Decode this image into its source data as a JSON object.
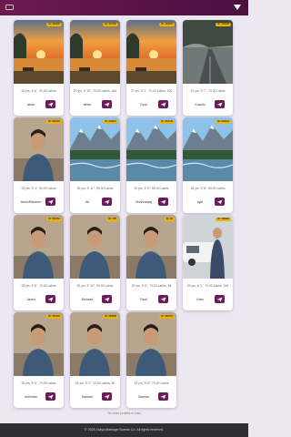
{
  "header": {
    "logo_icon": "logo-icon",
    "filter_icon": "filter-icon"
  },
  "colors": {
    "brand": "#5c1447",
    "badge": "#e9b500",
    "button": "#6a1c58"
  },
  "profiles": [
    {
      "badge": "ID: 459329",
      "info": "26 yrs, 5' 6\", 90,00 Lakhs",
      "name": "Ishan",
      "photo": "sunset-photo"
    },
    {
      "badge": "ID: 417000",
      "info": "22 yrs, 5' 10\", 70,00 Lakhs, 460",
      "name": "Ishan",
      "photo": "sunset-photo"
    },
    {
      "badge": "ID: 459250",
      "info": "27 yrs, 6' 1\", 70,00 Lakhs, 100",
      "name": "Dyal",
      "photo": "sunset-photo"
    },
    {
      "badge": "ID: 416998",
      "info": "31 yrs, 5' 7\", 70,00 Lakhs",
      "name": "Kaushi",
      "photo": "rainy-road-photo"
    },
    {
      "badge": "ID: 459191",
      "info": "29 yrs, 5' 4\", 90,00 Lakhs",
      "name": "AbdulRaheem",
      "photo": "man-photo"
    },
    {
      "badge": "ID: 416917",
      "info": "35 yrs, 5' 11\", 90,00 Lakhs",
      "name": "Ali",
      "photo": "mountain-photo"
    },
    {
      "badge": "ID: 459148",
      "info": "30 yrs, 5' 5\", 90,00 Lakhs",
      "name": "Shahnawaj",
      "photo": "mountain-photo"
    },
    {
      "badge": "ID: 459031",
      "info": "28 yrs, 5' 8\", 90,00 Lakhs",
      "name": "Iqbl",
      "photo": "mountain-photo"
    },
    {
      "badge": "ID: 394457",
      "info": "28 yrs, 5' 6\", 70,00 Lakhs",
      "name": "Javed",
      "photo": "man-photo"
    },
    {
      "badge": "ID: 378",
      "info": "26 yrs, 5' 10\", 90,00 Lakhs",
      "name": "Mohsad",
      "photo": "man-photo"
    },
    {
      "badge": "ID: 96",
      "info": "32 yrs, 5' 5\", 70,00 Lakhs, 64",
      "name": "Rauf",
      "photo": "man-photo"
    },
    {
      "badge": "ID: 459006",
      "info": "25 yrs, 6' 1\", 70,00 Lakhs, 446",
      "name": "Irfan",
      "photo": "man-car-photo"
    },
    {
      "badge": "ID: 457694",
      "info": "26 yrs, 5' 6\", 70,00 Lakhs",
      "name": "Imlimran",
      "photo": "man-photo"
    },
    {
      "badge": "ID: 389986",
      "info": "44 yrs, 6' 2\", 12,00 Lakhs, 60",
      "name": "Sameer",
      "photo": "man-photo"
    },
    {
      "badge": "ID: 389154",
      "info": "24 yrs, 5' 8\", 70,00 Lakhs",
      "name": "Salman",
      "photo": "man-photo"
    }
  ],
  "no_more_text": "No more profiles to load",
  "footer_text": "© 2025 Zaliya Marriage Bureau Co. All rights reserved."
}
